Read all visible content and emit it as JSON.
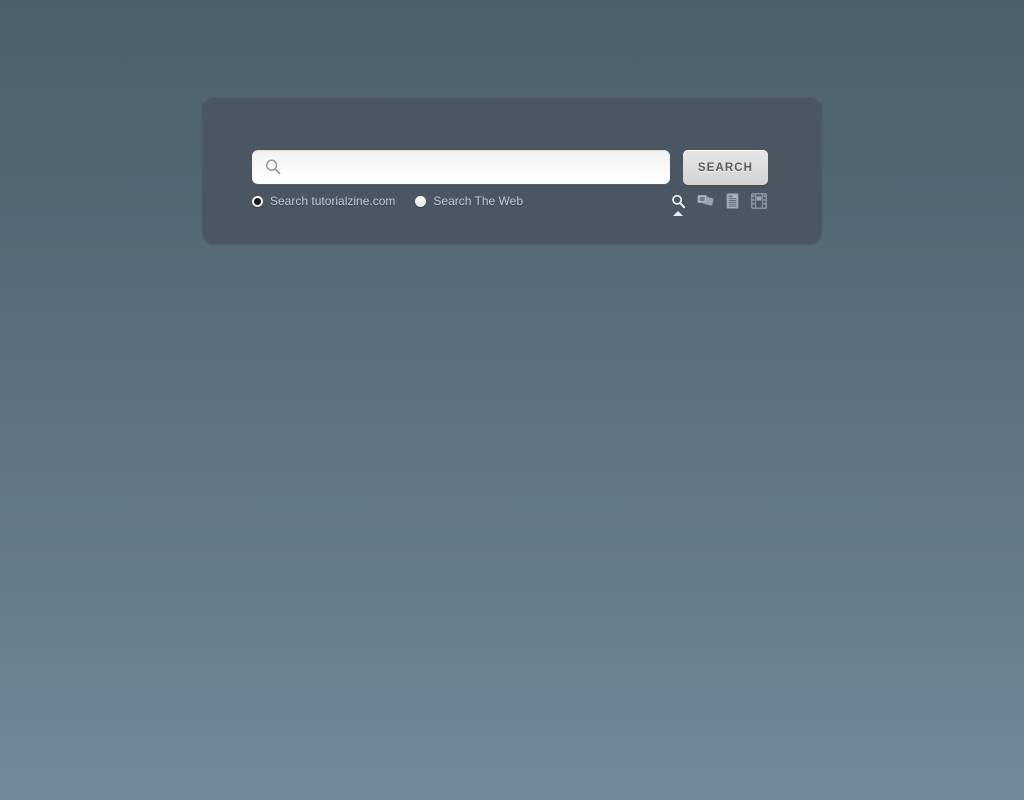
{
  "theme": {
    "bg_top": "#4d606a",
    "bg_bottom": "#728899",
    "panel_bg": "#4a5763",
    "label_color": "#c3cbd1",
    "button_text_color": "#5b5b5b",
    "accent_dot": "#141a20"
  },
  "panel": {
    "name": "search-widget"
  },
  "search": {
    "input_value": "",
    "placeholder": "",
    "input_icon": "magnifier-icon",
    "button_label": "SEARCH"
  },
  "scope_options": [
    {
      "id": "site",
      "label": "Search tutorialzine.com",
      "checked": true
    },
    {
      "id": "web",
      "label": "Search The Web",
      "checked": false
    }
  ],
  "tabs": [
    {
      "id": "web",
      "icon": "magnifier-icon",
      "label": "Web",
      "active": true
    },
    {
      "id": "images",
      "icon": "images-icon",
      "label": "Images",
      "active": false
    },
    {
      "id": "news",
      "icon": "document-icon",
      "label": "News",
      "active": false
    },
    {
      "id": "video",
      "icon": "film-icon",
      "label": "Video",
      "active": false
    }
  ]
}
